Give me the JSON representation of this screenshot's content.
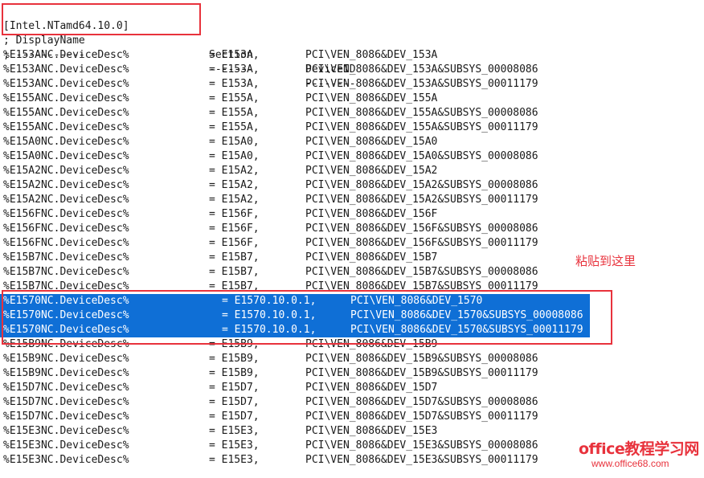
{
  "header": {
    "section_name": "[Intel.NTamd64.10.0]",
    "col_display": "; DisplayName",
    "col_section": "Section",
    "col_deviceid": "DeviceID"
  },
  "separator": {
    "c1": "; -----------",
    "c2": "-------",
    "c3": "--------"
  },
  "rows_top": [
    {
      "name": "%E153ANC.DeviceDesc%",
      "section": "= E153A,",
      "id": "PCI\\VEN_8086&DEV_153A"
    },
    {
      "name": "%E153ANC.DeviceDesc%",
      "section": "= E153A,",
      "id": "PCI\\VEN_8086&DEV_153A&SUBSYS_00008086"
    },
    {
      "name": "%E153ANC.DeviceDesc%",
      "section": "= E153A,",
      "id": "PCI\\VEN_8086&DEV_153A&SUBSYS_00011179"
    },
    {
      "name": "%E155ANC.DeviceDesc%",
      "section": "= E155A,",
      "id": "PCI\\VEN_8086&DEV_155A"
    },
    {
      "name": "%E155ANC.DeviceDesc%",
      "section": "= E155A,",
      "id": "PCI\\VEN_8086&DEV_155A&SUBSYS_00008086"
    },
    {
      "name": "%E155ANC.DeviceDesc%",
      "section": "= E155A,",
      "id": "PCI\\VEN_8086&DEV_155A&SUBSYS_00011179"
    },
    {
      "name": "%E15A0NC.DeviceDesc%",
      "section": "= E15A0,",
      "id": "PCI\\VEN_8086&DEV_15A0"
    },
    {
      "name": "%E15A0NC.DeviceDesc%",
      "section": "= E15A0,",
      "id": "PCI\\VEN_8086&DEV_15A0&SUBSYS_00008086"
    },
    {
      "name": "%E15A2NC.DeviceDesc%",
      "section": "= E15A2,",
      "id": "PCI\\VEN_8086&DEV_15A2"
    },
    {
      "name": "%E15A2NC.DeviceDesc%",
      "section": "= E15A2,",
      "id": "PCI\\VEN_8086&DEV_15A2&SUBSYS_00008086"
    },
    {
      "name": "%E15A2NC.DeviceDesc%",
      "section": "= E15A2,",
      "id": "PCI\\VEN_8086&DEV_15A2&SUBSYS_00011179"
    },
    {
      "name": "%E156FNC.DeviceDesc%",
      "section": "= E156F,",
      "id": "PCI\\VEN_8086&DEV_156F"
    },
    {
      "name": "%E156FNC.DeviceDesc%",
      "section": "= E156F,",
      "id": "PCI\\VEN_8086&DEV_156F&SUBSYS_00008086"
    },
    {
      "name": "%E156FNC.DeviceDesc%",
      "section": "= E156F,",
      "id": "PCI\\VEN_8086&DEV_156F&SUBSYS_00011179"
    },
    {
      "name": "%E15B7NC.DeviceDesc%",
      "section": "= E15B7,",
      "id": "PCI\\VEN_8086&DEV_15B7"
    },
    {
      "name": "%E15B7NC.DeviceDesc%",
      "section": "= E15B7,",
      "id": "PCI\\VEN_8086&DEV_15B7&SUBSYS_00008086"
    },
    {
      "name": "%E15B7NC.DeviceDesc%",
      "section": "= E15B7,",
      "id": "PCI\\VEN_8086&DEV_15B7&SUBSYS_00011179"
    }
  ],
  "rows_pasted": [
    {
      "name": "%E1570NC.DeviceDesc%",
      "section": "= E1570.10.0.1,",
      "id": "PCI\\VEN_8086&DEV_1570"
    },
    {
      "name": "%E1570NC.DeviceDesc%",
      "section": "= E1570.10.0.1,",
      "id": "PCI\\VEN_8086&DEV_1570&SUBSYS_00008086"
    },
    {
      "name": "%E1570NC.DeviceDesc%",
      "section": "= E1570.10.0.1,",
      "id": "PCI\\VEN_8086&DEV_1570&SUBSYS_00011179"
    }
  ],
  "rows_bottom": [
    {
      "name": "%E15B9NC.DeviceDesc%",
      "section": "= E15B9,",
      "id": "PCI\\VEN_8086&DEV_15B9"
    },
    {
      "name": "%E15B9NC.DeviceDesc%",
      "section": "= E15B9,",
      "id": "PCI\\VEN_8086&DEV_15B9&SUBSYS_00008086"
    },
    {
      "name": "%E15B9NC.DeviceDesc%",
      "section": "= E15B9,",
      "id": "PCI\\VEN_8086&DEV_15B9&SUBSYS_00011179"
    },
    {
      "name": "%E15D7NC.DeviceDesc%",
      "section": "= E15D7,",
      "id": "PCI\\VEN_8086&DEV_15D7"
    },
    {
      "name": "%E15D7NC.DeviceDesc%",
      "section": "= E15D7,",
      "id": "PCI\\VEN_8086&DEV_15D7&SUBSYS_00008086"
    },
    {
      "name": "%E15D7NC.DeviceDesc%",
      "section": "= E15D7,",
      "id": "PCI\\VEN_8086&DEV_15D7&SUBSYS_00011179"
    },
    {
      "name": "%E15E3NC.DeviceDesc%",
      "section": "= E15E3,",
      "id": "PCI\\VEN_8086&DEV_15E3"
    },
    {
      "name": "%E15E3NC.DeviceDesc%",
      "section": "= E15E3,",
      "id": "PCI\\VEN_8086&DEV_15E3&SUBSYS_00008086"
    },
    {
      "name": "%E15E3NC.DeviceDesc%",
      "section": "= E15E3,",
      "id": "PCI\\VEN_8086&DEV_15E3&SUBSYS_00011179"
    }
  ],
  "annotation": {
    "note": "粘贴到这里"
  },
  "watermark": {
    "brand": "office教程学习网",
    "url": "www.office68.com"
  },
  "colors": {
    "selection": "#0f6fd6",
    "annotation": "#e8323c"
  }
}
